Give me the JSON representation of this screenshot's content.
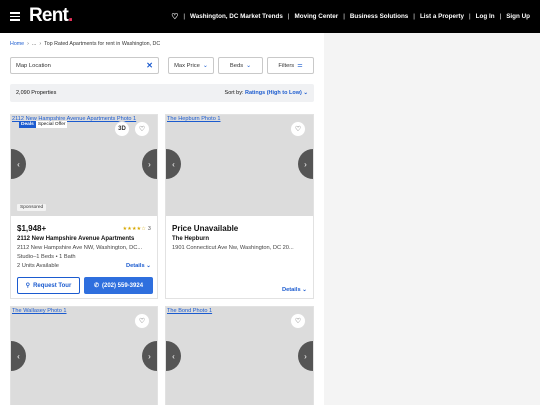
{
  "header": {
    "logo_text": "Rent",
    "logo_dot": ".",
    "nav": [
      "Washington, DC Market Trends",
      "Moving Center",
      "Business Solutions",
      "List a Property",
      "Log In",
      "Sign Up"
    ],
    "heart_icon": "♡"
  },
  "breadcrumb": {
    "home": "Home",
    "ellipsis": "...",
    "current": "Top Rated Apartments for rent in Washington, DC"
  },
  "filters": {
    "search_placeholder": "Map Location",
    "max_price": "Max Price",
    "beds": "Beds",
    "filters": "Filters"
  },
  "results": {
    "count": "2,090 Properties",
    "sort_label": "Sort by:",
    "sort_value": "Ratings (High to Low)"
  },
  "cards": [
    {
      "photo_alt": "2112 New Hampshire Avenue Apartments Photo 1",
      "deals": "Deals",
      "special": "Special Offer",
      "three_d": "3D",
      "sponsored": "Sponsored",
      "price": "$1,948+",
      "rating_count": "3",
      "name": "2112 New Hampshire Avenue Apartments",
      "address": "2112 New Hampshire Ave NW, Washington, DC...",
      "beds_baths": "Studio–1 Beds • 1 Bath",
      "units": "2 Units Available",
      "details": "Details",
      "tour": "Request Tour",
      "phone": "(202) 559-3924"
    },
    {
      "photo_alt": "The Hepburn Photo 1",
      "price": "Price Unavailable",
      "name": "The Hepburn",
      "address": "1901 Connecticut Ave Nw, Washington, DC 20...",
      "details": "Details"
    },
    {
      "photo_alt": "The Wallasey Photo 1"
    },
    {
      "photo_alt": "The Bond Photo 1"
    }
  ],
  "colors": {
    "header_bg": "#000000",
    "accent_blue": "#1b5bcf",
    "logo_dot": "#e8315b"
  }
}
